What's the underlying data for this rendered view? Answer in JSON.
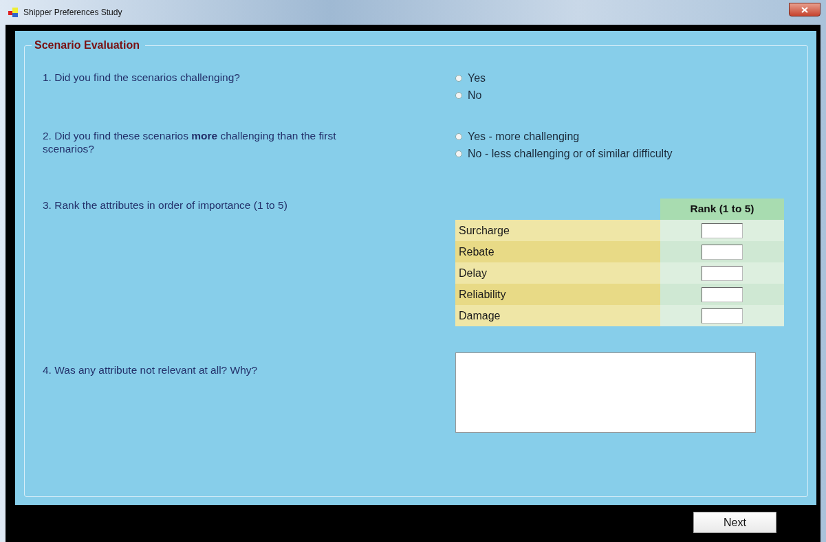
{
  "window": {
    "title": "Shipper Preferences Study"
  },
  "section": {
    "title": "Scenario Evaluation"
  },
  "questions": [
    {
      "kind": "radio",
      "text": "1. Did you find the scenarios challenging?",
      "options": [
        {
          "label": "Yes",
          "selected": false
        },
        {
          "label": "No",
          "selected": false
        }
      ]
    },
    {
      "kind": "radio",
      "text": "2. Did you find these scenarios **more**  challenging than the first scenarios?",
      "options": [
        {
          "label": "Yes - more challenging",
          "selected": false
        },
        {
          "label": "No - less challenging or of similar difficulty",
          "selected": false
        }
      ]
    },
    {
      "kind": "rank",
      "text": "3. Rank the attributes in order of importance (1 to 5)",
      "column": "Rank (1 to 5)",
      "rows": [
        {
          "label": "Surcharge"
        },
        {
          "label": "Rebate"
        },
        {
          "label": "Delay"
        },
        {
          "label": "Reliability"
        },
        {
          "label": "Damage"
        }
      ]
    },
    {
      "kind": "text",
      "text": "4. Was any attribute not relevant at all? Why?"
    }
  ],
  "buttons": [
    {
      "label": "Next"
    }
  ]
}
